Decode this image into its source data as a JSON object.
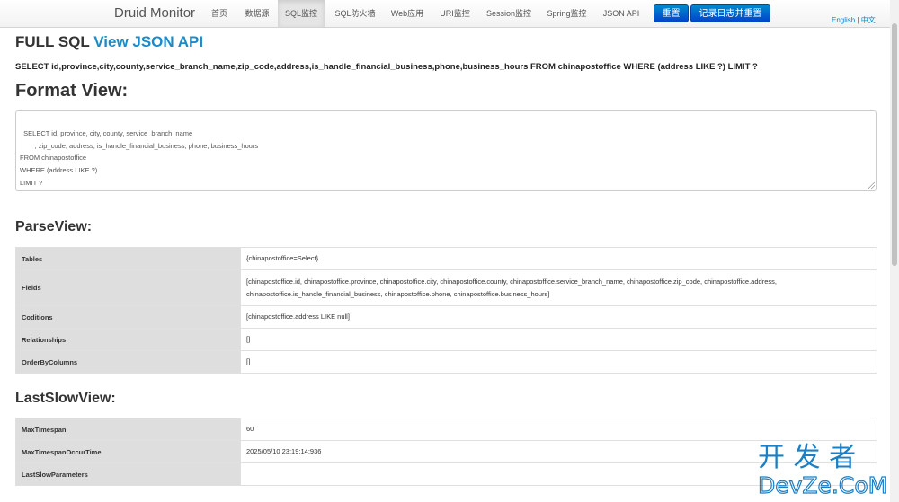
{
  "navbar": {
    "brand": "Druid Monitor",
    "items": [
      "首页",
      "数据源",
      "SQL监控",
      "SQL防火墙",
      "Web应用",
      "URI监控",
      "Session监控",
      "Spring监控",
      "JSON API"
    ],
    "active_index": 2,
    "reset_label": "重置",
    "log_reset_label": "记录日志并重置",
    "lang_en": "English",
    "lang_sep": "|",
    "lang_zh": "中文"
  },
  "header": {
    "title_prefix": "FULL SQL",
    "title_link": "View JSON API"
  },
  "sql": "SELECT id,province,city,county,service_branch_name,zip_code,address,is_handle_financial_business,phone,business_hours FROM chinapostoffice WHERE (address LIKE ?) LIMIT ?",
  "format_view": {
    "heading": "Format View:",
    "text": "SELECT id, province, city, county, service_branch_name\n\t, zip_code, address, is_handle_financial_business, phone, business_hours\nFROM chinapostoffice\nWHERE (address LIKE ?)\nLIMIT ?"
  },
  "parse_view": {
    "heading": "ParseView:",
    "rows": [
      {
        "key": "Tables",
        "value": "{chinapostoffice=Select}"
      },
      {
        "key": "Fields",
        "value": "[chinapostoffice.id, chinapostoffice.province, chinapostoffice.city, chinapostoffice.county, chinapostoffice.service_branch_name, chinapostoffice.zip_code, chinapostoffice.address, chinapostoffice.is_handle_financial_business, chinapostoffice.phone, chinapostoffice.business_hours]"
      },
      {
        "key": "Coditions",
        "value": "[chinapostoffice.address LIKE null]"
      },
      {
        "key": "Relationships",
        "value": "[]"
      },
      {
        "key": "OrderByColumns",
        "value": "[]"
      }
    ]
  },
  "last_slow_view": {
    "heading": "LastSlowView:",
    "rows": [
      {
        "key": "MaxTimespan",
        "value": "60"
      },
      {
        "key": "MaxTimespanOccurTime",
        "value": "2025/05/10 23:19:14:936"
      },
      {
        "key": "LastSlowParameters",
        "value": ""
      }
    ]
  },
  "watermark": {
    "line1": "开 发 者",
    "line2": "DevZe.CoM"
  },
  "colors": {
    "accent": "#1a8bc9",
    "button": "#0066cc",
    "key_cell": "#dedede"
  }
}
